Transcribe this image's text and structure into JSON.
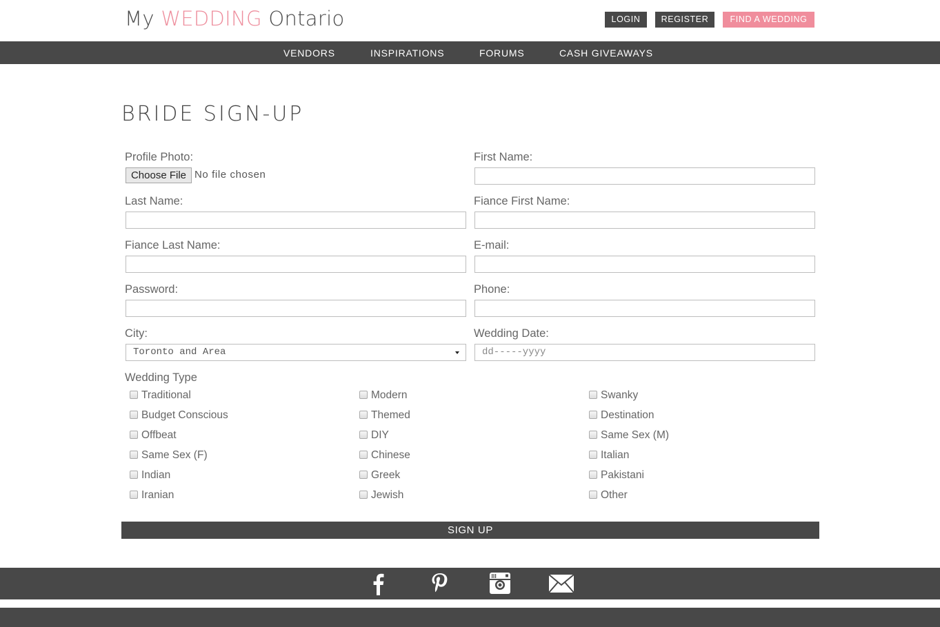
{
  "header": {
    "logo_prefix": "My ",
    "logo_accent": "WEDDING",
    "logo_suffix": " Ontario",
    "login": "LOGIN",
    "register": "REGISTER",
    "find_wedding": "FIND A WEDDING"
  },
  "nav": {
    "items": [
      "VENDORS",
      "INSPIRATIONS",
      "FORUMS",
      "CASH GIVEAWAYS"
    ]
  },
  "page": {
    "title": "BRIDE SIGN-UP"
  },
  "form": {
    "profile_photo_label": "Profile Photo:",
    "choose_file": "Choose File",
    "no_file": "No file chosen",
    "first_name_label": "First Name:",
    "last_name_label": "Last Name:",
    "fiance_first_name_label": "Fiance First Name:",
    "fiance_last_name_label": "Fiance Last Name:",
    "email_label": "E-mail:",
    "password_label": "Password:",
    "phone_label": "Phone:",
    "city_label": "City:",
    "city_value": "Toronto and Area",
    "wedding_date_label": "Wedding Date:",
    "wedding_date_placeholder": "dd-----yyyy",
    "wedding_type_label": "Wedding Type",
    "wedding_types": [
      "Traditional",
      "Modern",
      "Swanky",
      "Budget Conscious",
      "Themed",
      "Destination",
      "Offbeat",
      "DIY",
      "Same Sex (M)",
      "Same Sex (F)",
      "Chinese",
      "Italian",
      "Indian",
      "Greek",
      "Pakistani",
      "Iranian",
      "Jewish",
      "Other"
    ],
    "signup": "SIGN UP"
  },
  "footer": {
    "icons": [
      "facebook-icon",
      "pinterest-icon",
      "instagram-icon",
      "email-icon"
    ]
  },
  "colors": {
    "accent": "#f08d9c",
    "dark": "#484848"
  }
}
